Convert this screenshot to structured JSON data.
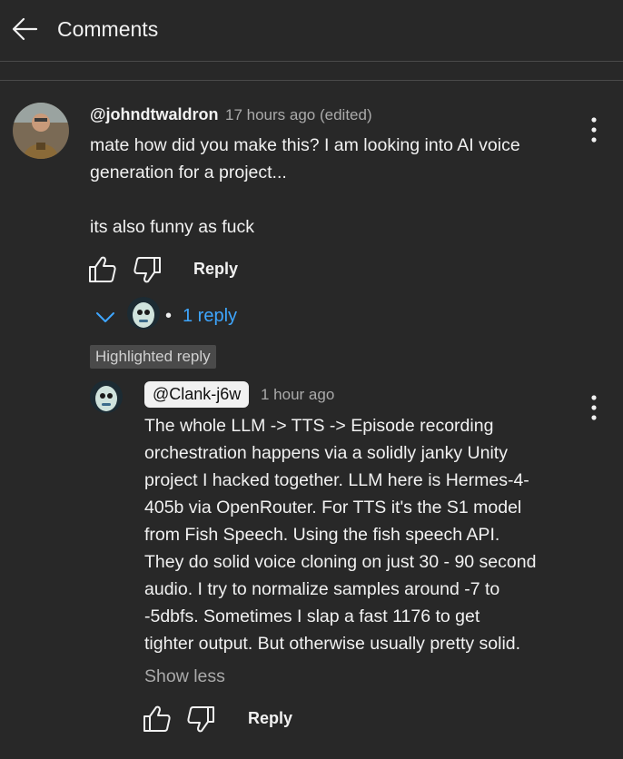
{
  "header": {
    "back_icon": "arrow-left-icon",
    "title": "Comments"
  },
  "comment": {
    "author": "@johndtwaldron",
    "time": "17 hours ago (edited)",
    "text_line1": "mate how did you make this? I am looking into AI voice",
    "text_line2": "generation for a project...",
    "text_line3": "its also funny as fuck",
    "reply_label": "Reply",
    "icons": {
      "like": "thumbs-up-icon",
      "dislike": "thumbs-down-icon",
      "menu": "more-vert-icon"
    }
  },
  "replies_toggle": {
    "separator": "•",
    "count_label": "1 reply",
    "icon": "chevron-down-icon"
  },
  "highlighted_reply": {
    "badge": "Highlighted reply",
    "author": "@Clank-j6w",
    "time": "1 hour ago",
    "lines": [
      "The whole LLM -> TTS -> Episode recording",
      "orchestration happens via a solidly janky Unity",
      "project I hacked together. LLM here is Hermes-4-",
      "405b via OpenRouter. For TTS it's the S1 model",
      "from Fish Speech. Using the fish speech API.",
      "They do solid voice cloning on just 30 - 90 second",
      "audio. I try to normalize samples around -7 to",
      "-5dbfs. Sometimes I slap a fast 1176 to get",
      "tighter output. But otherwise usually pretty solid."
    ],
    "show_less": "Show less",
    "reply_label": "Reply"
  },
  "colors": {
    "background": "#282828",
    "link_blue": "#3ea6ff",
    "muted": "#aaaaaa"
  }
}
